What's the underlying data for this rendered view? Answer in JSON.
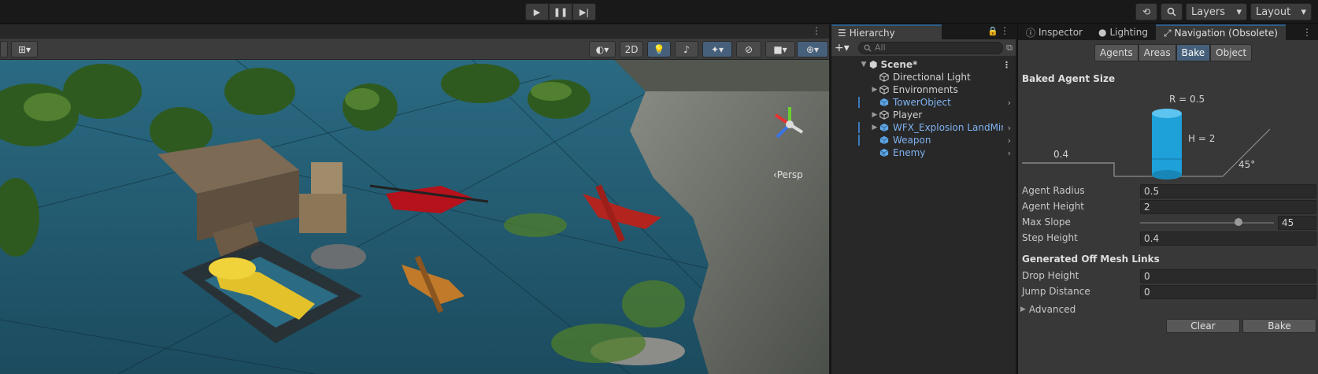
{
  "toolbar": {
    "play_icon": "play-icon",
    "pause_icon": "pause-icon",
    "step_icon": "step-icon",
    "history_icon": "history-icon",
    "search_icon": "search-icon",
    "layers_label": "Layers",
    "layout_label": "Layout"
  },
  "scene": {
    "mode_2d": "2D",
    "persp_label": "‹Persp"
  },
  "hierarchy": {
    "tab_label": "Hierarchy",
    "search_placeholder": "All",
    "root": "Scene*",
    "items": [
      {
        "label": "Directional Light",
        "prefab": false,
        "expandable": false
      },
      {
        "label": "Environments",
        "prefab": false,
        "expandable": true
      },
      {
        "label": "TowerObject",
        "prefab": true,
        "expandable": false
      },
      {
        "label": "Player",
        "prefab": false,
        "expandable": true
      },
      {
        "label": "WFX_Explosion LandMine",
        "prefab": true,
        "expandable": true
      },
      {
        "label": "Weapon",
        "prefab": true,
        "expandable": false
      },
      {
        "label": "Enemy",
        "prefab": true,
        "expandable": false
      }
    ]
  },
  "inspector": {
    "tabs": [
      "Inspector",
      "Lighting",
      "Navigation (Obsolete)"
    ],
    "segments": [
      "Agents",
      "Areas",
      "Bake",
      "Object"
    ],
    "active_segment": "Bake",
    "baked_agent_header": "Baked Agent Size",
    "diagram": {
      "r": "R = 0.5",
      "h": "H = 2",
      "step": "0.4",
      "slope": "45°"
    },
    "fields": {
      "agent_radius": {
        "label": "Agent Radius",
        "value": "0.5"
      },
      "agent_height": {
        "label": "Agent Height",
        "value": "2"
      },
      "max_slope": {
        "label": "Max Slope",
        "value": "45",
        "fraction": 0.75
      },
      "step_height": {
        "label": "Step Height",
        "value": "0.4"
      }
    },
    "offmesh_header": "Generated Off Mesh Links",
    "offmesh": {
      "drop_height": {
        "label": "Drop Height",
        "value": "0"
      },
      "jump_distance": {
        "label": "Jump Distance",
        "value": "0"
      }
    },
    "advanced_label": "Advanced",
    "clear_label": "Clear",
    "bake_label": "Bake"
  },
  "colors": {
    "accent": "#46607c",
    "prefab_text": "#7fb2f0",
    "agent_cylinder": "#1ea0d8"
  }
}
